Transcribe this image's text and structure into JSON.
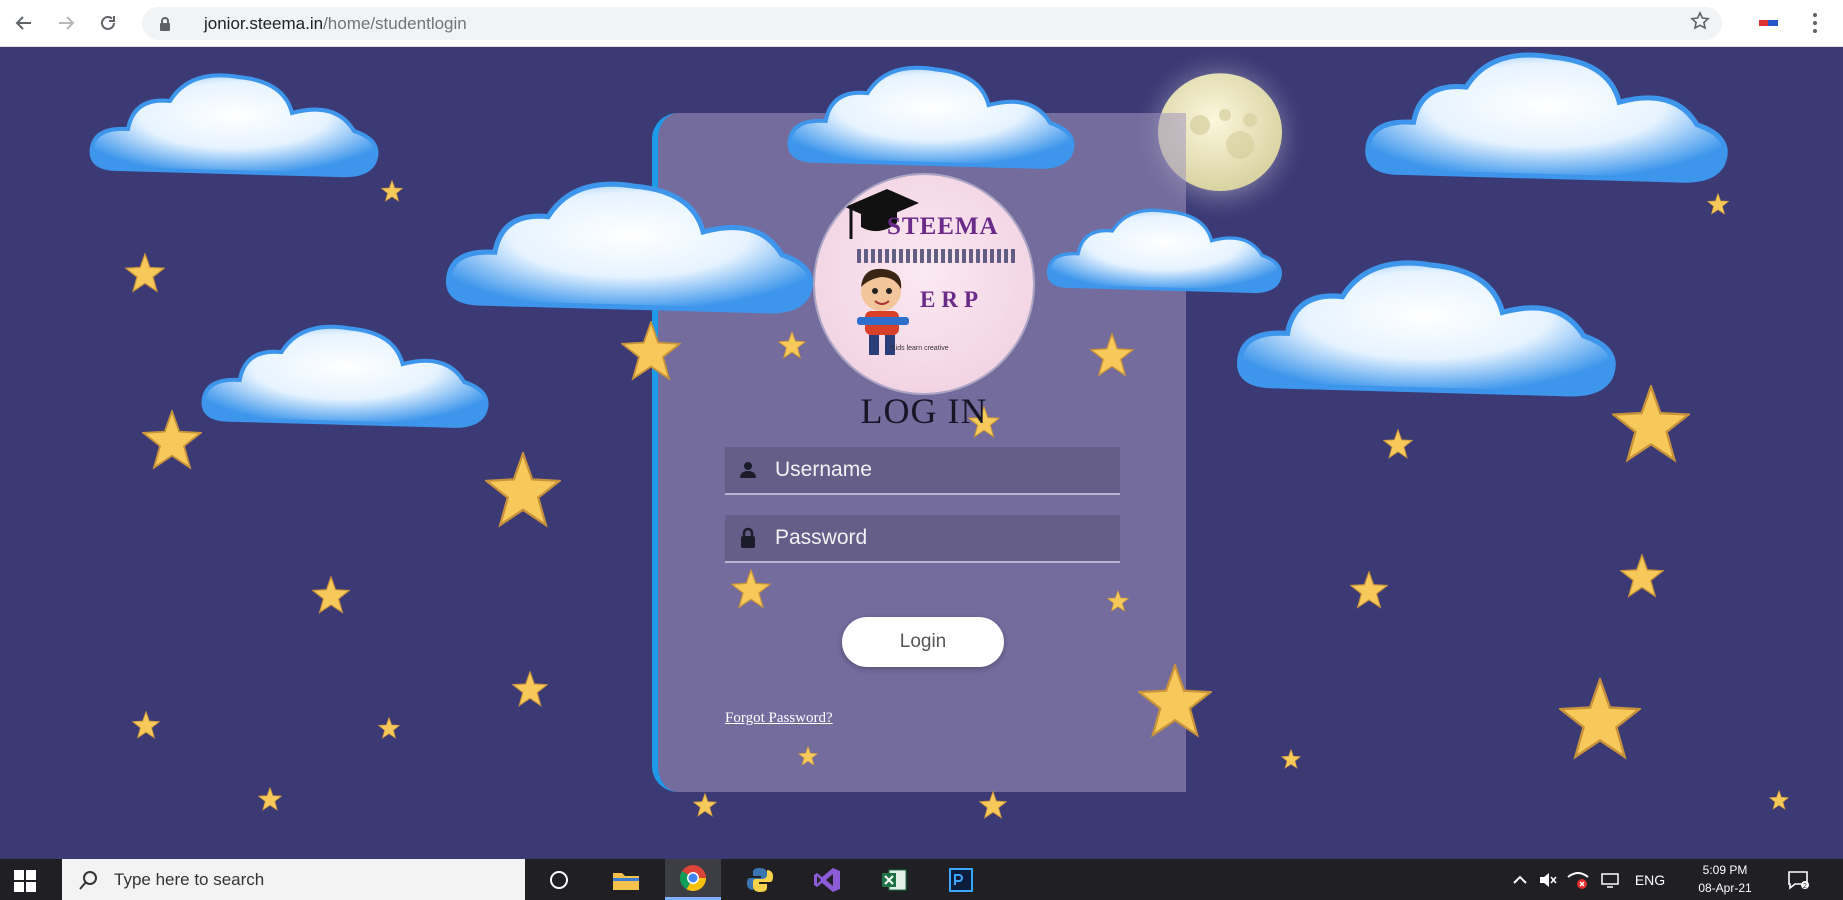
{
  "browser": {
    "url_host": "jonior.steema.in",
    "url_path": "/home/studentlogin",
    "back_icon": "arrow-left-icon",
    "forward_icon": "arrow-right-icon",
    "reload_icon": "reload-icon",
    "bookmark_icon": "star-outline-icon"
  },
  "logo": {
    "brand": "STEEMA",
    "product": "ERP",
    "tagline": "Kids learn creative"
  },
  "login": {
    "title": "LOG IN",
    "username_placeholder": "Username",
    "password_placeholder": "Password",
    "button_label": "Login",
    "forgot_label": "Forgot Password?"
  },
  "taskbar": {
    "search_placeholder": "Type here to search",
    "language": "ENG",
    "time": "5:09 PM",
    "date": "08-Apr-21"
  },
  "colors": {
    "sky": "#3c3a75",
    "card_accent": "#1e9be8",
    "star_fill": "#f7c95a",
    "cloud_blue": "#3d96ec"
  }
}
